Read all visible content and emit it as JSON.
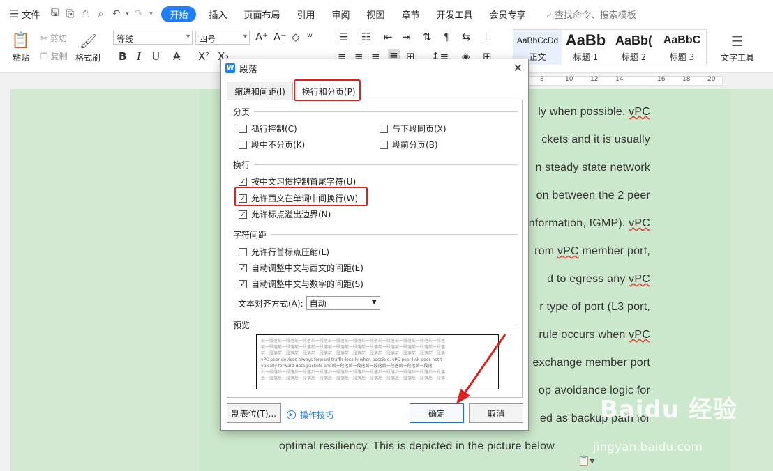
{
  "menu": {
    "file": "文件",
    "tabs": [
      "开始",
      "插入",
      "页面布局",
      "引用",
      "审阅",
      "视图",
      "章节",
      "开发工具",
      "会员专享"
    ],
    "search": "查找命令、搜索模板"
  },
  "ribbon": {
    "paste": "粘贴",
    "cut": "剪切",
    "copy": "复制",
    "format_painter": "格式刷",
    "font": "等线",
    "size": "四号",
    "styles": [
      {
        "sample": "AaBbCcDd",
        "name": "正文"
      },
      {
        "sample": "AaBb",
        "name": "标题 1"
      },
      {
        "sample": "AaBb(",
        "name": "标题 2"
      },
      {
        "sample": "AaBbC",
        "name": "标题 3"
      }
    ],
    "text_tools": "文字工具"
  },
  "ruler": {
    "marks": [
      "8",
      "10",
      "12",
      "14",
      "16",
      "18",
      "20"
    ]
  },
  "document": {
    "lines": [
      {
        "text": "ly when possible. vPC",
        "wavy": "vPC"
      },
      {
        "text": "ckets and it is usually"
      },
      {
        "text": "n steady state network"
      },
      {
        "text": "on between the 2 peer"
      },
      {
        "text": "nformation, IGMP). vPC",
        "wavy": "vPC"
      },
      {
        "text": "rom vPC member port,",
        "wavy": "vPC"
      },
      {
        "text": "d to egress any vPC",
        "wavy": "vPC"
      },
      {
        "text": "r type of port (L3 port,"
      },
      {
        "text": "rule occurs when vPC",
        "wavy": "vPC"
      },
      {
        "text": "exchange member port"
      },
      {
        "text": "op avoidance logic for"
      },
      {
        "text": "ed as backup path for"
      }
    ],
    "last_line": "optimal resiliency. This is depicted in the picture below"
  },
  "watermark": {
    "logo": "Baidu 经验",
    "url": "jingyan.baidu.com"
  },
  "dialog": {
    "icon": "W",
    "title": "段落",
    "tabs": [
      "缩进和间距(I)",
      "换行和分页(P)"
    ],
    "groups": {
      "pagination": "分页",
      "line_break": "换行",
      "char_spacing": "字符间距",
      "preview": "预览"
    },
    "checkboxes": [
      {
        "label": "孤行控制(C)",
        "checked": false
      },
      {
        "label": "与下段同页(X)",
        "checked": false
      },
      {
        "label": "段中不分页(K)",
        "checked": false
      },
      {
        "label": "段前分页(B)",
        "checked": false
      },
      {
        "label": "按中文习惯控制首尾字符(U)",
        "checked": true
      },
      {
        "label": "允许西文在单词中间换行(W)",
        "checked": true
      },
      {
        "label": "允许标点溢出边界(N)",
        "checked": true
      },
      {
        "label": "允许行首标点压缩(L)",
        "checked": false
      },
      {
        "label": "自动调整中文与西文的间距(E)",
        "checked": true
      },
      {
        "label": "自动调整中文与数字的间距(S)",
        "checked": true
      }
    ],
    "align_label": "文本对齐方式(A):",
    "align_value": "自动",
    "preview_lines": [
      "前一段落前一段落前一段落前一段落前一段落前一段落前一段落前一段落前一段落前一段落前一段落",
      "前一段落前一段落前一段落前一段落前一段落前一段落前一段落前一段落前一段落前一段落前一段落",
      "前一段落前一段落前一段落前一段落前一段落前一段落前一段落前一段落前一段落前一段落前一段落",
      "vPC peer devices always forward traffic locally when possible. vPC peer-link does not t",
      "ypically forward data packets and后一段落后一段落后一段落后一段落后一段落后一段落",
      "后一段落后一段落后一段落后一段落后一段落后一段落后一段落后一段落后一段落后一段落后一段落",
      "后一段落后一段落后一段落后一段落后一段落后一段落后一段落后一段落后一段落后一段落后一段落"
    ],
    "tab_stops_button": "制表位(T)...",
    "tips": "操作技巧",
    "ok": "确定",
    "cancel": "取消"
  }
}
